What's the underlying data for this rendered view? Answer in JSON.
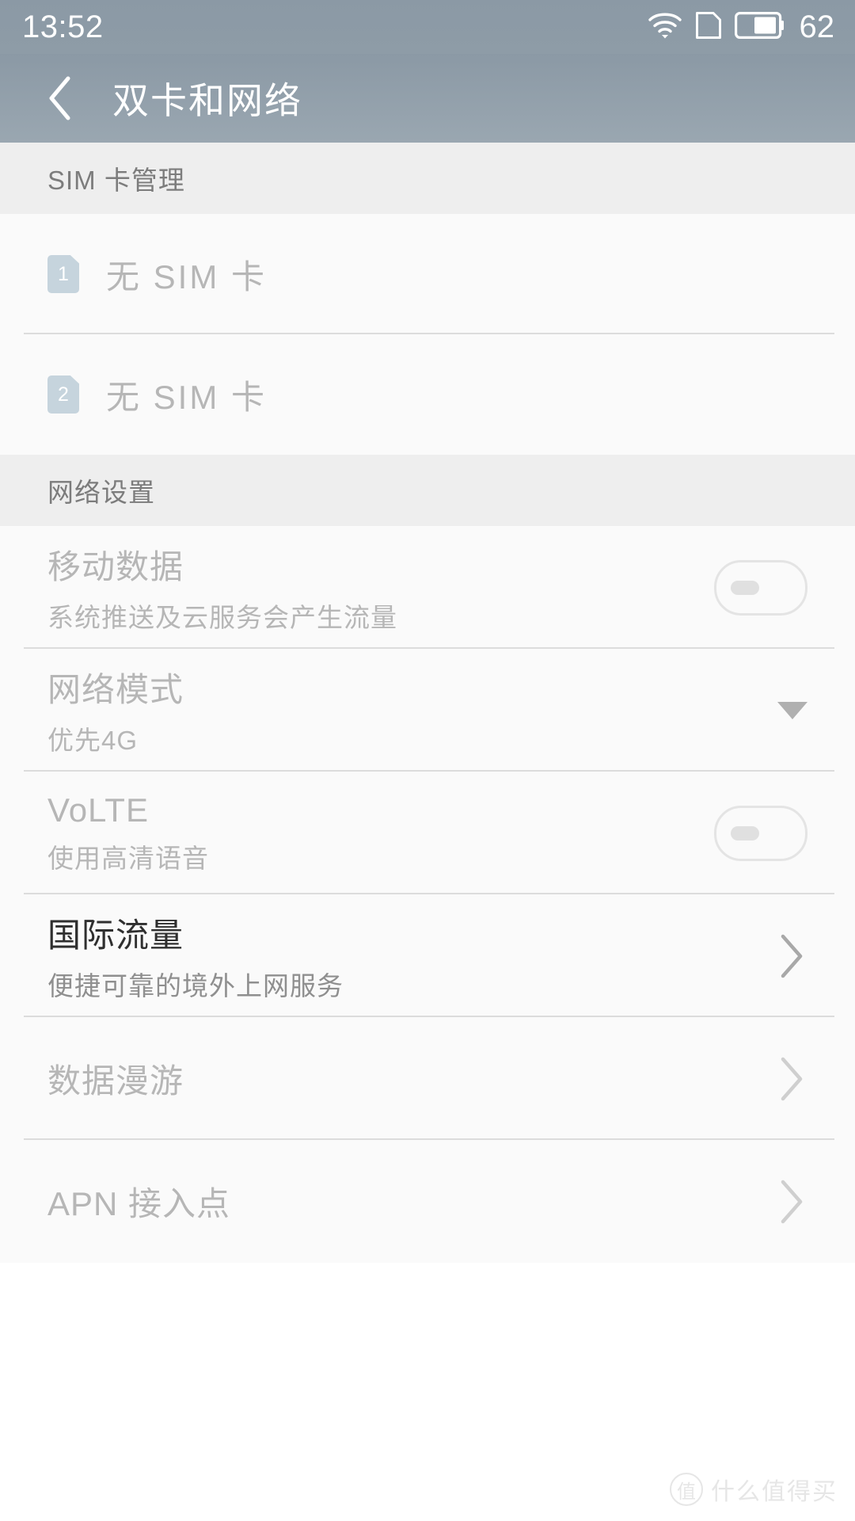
{
  "status_bar": {
    "time": "13:52",
    "battery_level": "62",
    "icons": [
      "wifi-icon",
      "sim-card-icon",
      "battery-icon"
    ]
  },
  "header": {
    "back_label": "‹",
    "title": "双卡和网络"
  },
  "sections": [
    {
      "header": "SIM 卡管理",
      "rows": [
        {
          "type": "sim",
          "badge": "1",
          "label": "无 SIM 卡",
          "enabled": false
        },
        {
          "type": "sim",
          "badge": "2",
          "label": "无 SIM 卡",
          "enabled": false
        }
      ]
    },
    {
      "header": "网络设置",
      "rows": [
        {
          "type": "toggle",
          "title": "移动数据",
          "subtitle": "系统推送及云服务会产生流量",
          "toggle_state": "off",
          "enabled": false
        },
        {
          "type": "dropdown",
          "title": "网络模式",
          "subtitle": "优先4G",
          "enabled": false
        },
        {
          "type": "toggle",
          "title": "VoLTE",
          "subtitle": "使用高清语音",
          "toggle_state": "off",
          "enabled": false
        },
        {
          "type": "link",
          "title": "国际流量",
          "subtitle": "便捷可靠的境外上网服务",
          "enabled": true
        },
        {
          "type": "link",
          "title": "数据漫游",
          "subtitle": "",
          "enabled": false
        },
        {
          "type": "link",
          "title": "APN 接入点",
          "subtitle": "",
          "enabled": false
        }
      ]
    }
  ],
  "watermark": {
    "badge": "值",
    "text": "什么值得买"
  },
  "colors": {
    "header_bg": "#8e9ca7",
    "page_bg": "#fafafa",
    "section_header_bg": "#eeeeee",
    "sim_badge": "#c6d4dd",
    "text_disabled": "#b6b6b6",
    "text_enabled": "#2f2f2f"
  }
}
